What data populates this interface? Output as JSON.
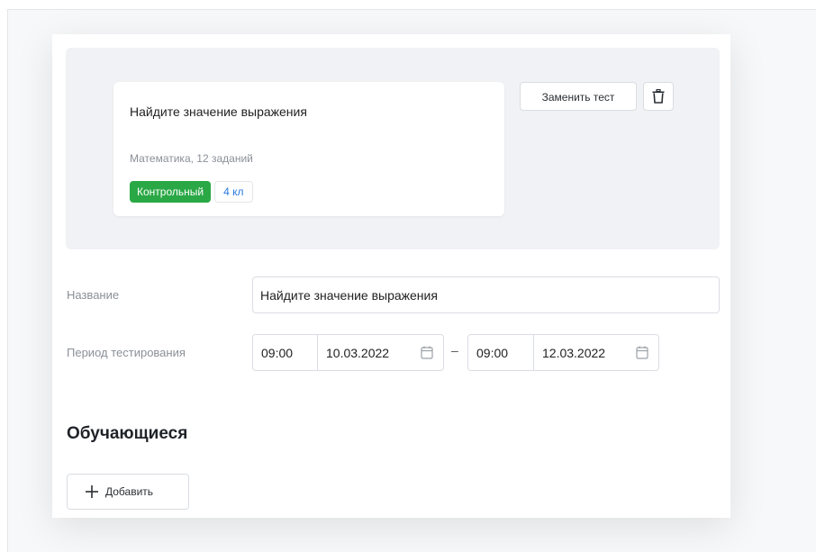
{
  "test_card": {
    "title": "Найдите значение выражения",
    "meta": "Математика, 12 заданий",
    "badge_type": "Контрольный",
    "badge_grade": "4 кл"
  },
  "actions": {
    "replace_label": "Заменить тест",
    "delete_icon": "trash-icon"
  },
  "form": {
    "name_label": "Название",
    "name_value": "Найдите значение выражения",
    "period_label": "Период тестирования",
    "start_time": "09:00",
    "start_date": "10.03.2022",
    "separator": "–",
    "end_time": "09:00",
    "end_date": "12.03.2022"
  },
  "students": {
    "title": "Обучающиеся",
    "add_label": "Добавить"
  },
  "colors": {
    "badge_green": "#29a845",
    "grade_blue": "#2b7be0"
  }
}
